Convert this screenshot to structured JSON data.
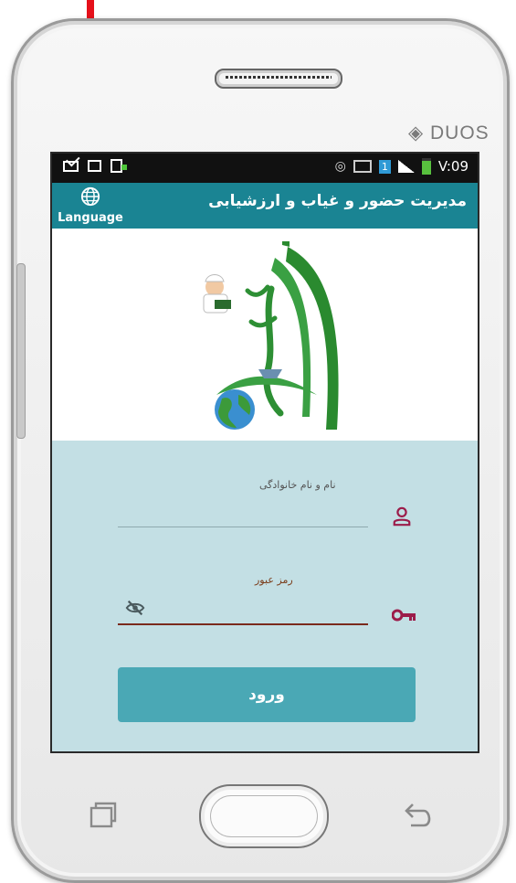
{
  "device": {
    "brand_label": "DUOS"
  },
  "status_bar": {
    "sim_slot": "1",
    "time": "V:09"
  },
  "app_bar": {
    "language_label": "Language",
    "title": "مدیریت حضور و غیاب و ارزشیابی"
  },
  "form": {
    "name_label": "نام و نام خانوادگی",
    "name_value": "",
    "password_label": "رمز عبور",
    "password_value": "",
    "login_label": "ورود"
  },
  "colors": {
    "app_bar": "#1a8493",
    "form_background": "#c3dfe4",
    "login_button": "#4aa8b5",
    "icon_accent": "#9c1c4a",
    "password_underline": "#7a2a1c",
    "annotation_arrow": "#e5101a"
  },
  "icons": {
    "language": "globe-icon",
    "name_field": "person-icon",
    "password_field": "key-icon",
    "visibility": "eye-off-icon",
    "nav_recent": "recent-apps-icon",
    "nav_back": "back-arrow-icon"
  }
}
